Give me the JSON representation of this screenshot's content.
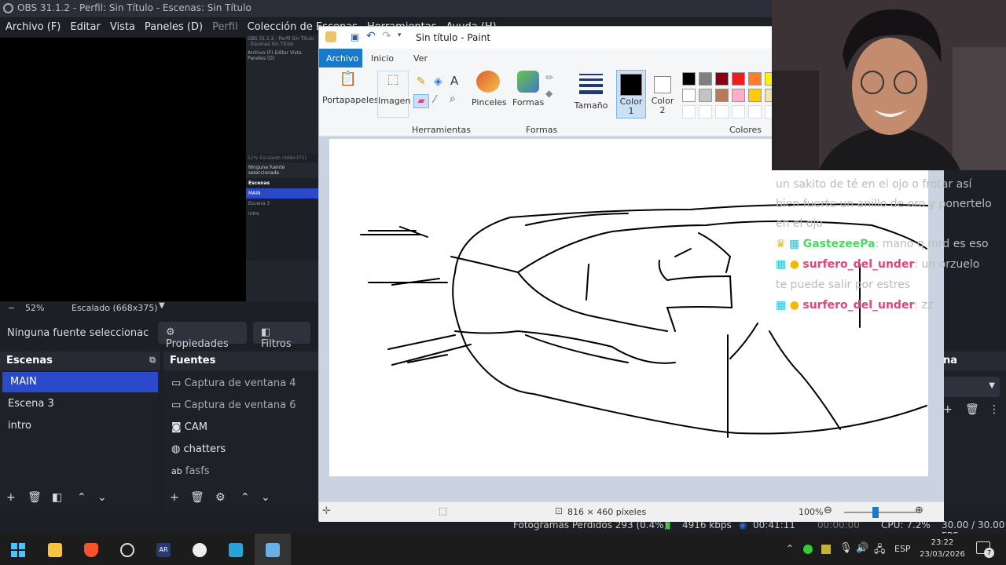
{
  "obs": {
    "title": "OBS 31.1.2 - Perfil: Sin Título - Escenas: Sin Título",
    "menu": [
      "Archivo (F)",
      "Editar",
      "Vista",
      "Paneles (D)",
      "Perfil",
      "Colección de Escenas",
      "Herramientas",
      "Ayuda (H)"
    ],
    "zoom": "52%",
    "scale": "Escalado (668x375)",
    "no_source": "Ninguna fuente seleccionac",
    "properties": "Propiedades",
    "filters": "Filtros",
    "scenes_title": "Escenas",
    "scenes": [
      "MAIN",
      "Escena 3",
      "intro"
    ],
    "sources_title": "Fuentes",
    "sources": [
      {
        "icon": "window-icon",
        "label": "Captura de ventana 4"
      },
      {
        "icon": "window-icon",
        "label": "Captura de ventana 6"
      },
      {
        "icon": "camera-icon",
        "label": "CAM"
      },
      {
        "icon": "browser-icon",
        "label": "chatters"
      },
      {
        "icon": "text-icon",
        "label": "fasfs"
      }
    ],
    "right_dock_title": "na",
    "status": {
      "dropped": "Fotogramas Perdidos 293 (0.4%)",
      "bitrate": "4916 kbps",
      "rec_time": "00:41:11",
      "rec_time2": "00:00:00",
      "cpu": "CPU: 7.2%",
      "fps": "30.00 / 30.00 FPS"
    },
    "nested": {
      "title": "OBS 31.1.2 - Perfil Sin Título - Escenas Sin Título",
      "menu": "Archivo (F)   Editar   Vista   Paneles (D)",
      "zoom": "52%     Escalado (668x375)",
      "no_source": "Ninguna fuente seleccionada",
      "scenes_title": "Escenas",
      "scenes": [
        "MAIN",
        "Escena 3",
        "intro"
      ]
    }
  },
  "paint": {
    "title": "Sin título - Paint",
    "tabs": [
      "Archivo",
      "Inicio",
      "Ver"
    ],
    "groups": {
      "clipboard": "Portapapeles",
      "image": "Imagen",
      "tools": "Herramientas",
      "brushes": "Pinceles",
      "shapes": "Formas",
      "shapes_group": "Formas",
      "size": "Tamaño",
      "color1": "Color 1",
      "color2": "Color 2",
      "colors": "Colores"
    },
    "palette_row1": [
      "#000000",
      "#7f7f7f",
      "#880015",
      "#ed1c24",
      "#ff7f27",
      "#fff200"
    ],
    "palette_row2": [
      "#ffffff",
      "#c3c3c3",
      "#b97a57",
      "#ffaec9",
      "#ffc90e",
      "#efe4b0"
    ],
    "canvas_size": "816 × 460 píxeles",
    "zoom": "100%"
  },
  "chat": {
    "lines": [
      {
        "user": "",
        "color": "",
        "text": "un sakito de té en el ojo o frotar así bien fuerte un anillo de oro y ponertelo en el ojo"
      },
      {
        "user": "GastezeePa",
        "color": "#4cd964",
        "text": ": mano q mrd es eso"
      },
      {
        "user": "surfero_del_under",
        "color": "#e0457b",
        "text": ": un orzuelo te puede salir por estres"
      },
      {
        "user": "surfero_del_under",
        "color": "#e0457b",
        "text": ": zz"
      }
    ]
  },
  "taskbar": {
    "lang": "ESP",
    "time": "23:22",
    "date": "23/03/2026",
    "notif_count": "7"
  }
}
